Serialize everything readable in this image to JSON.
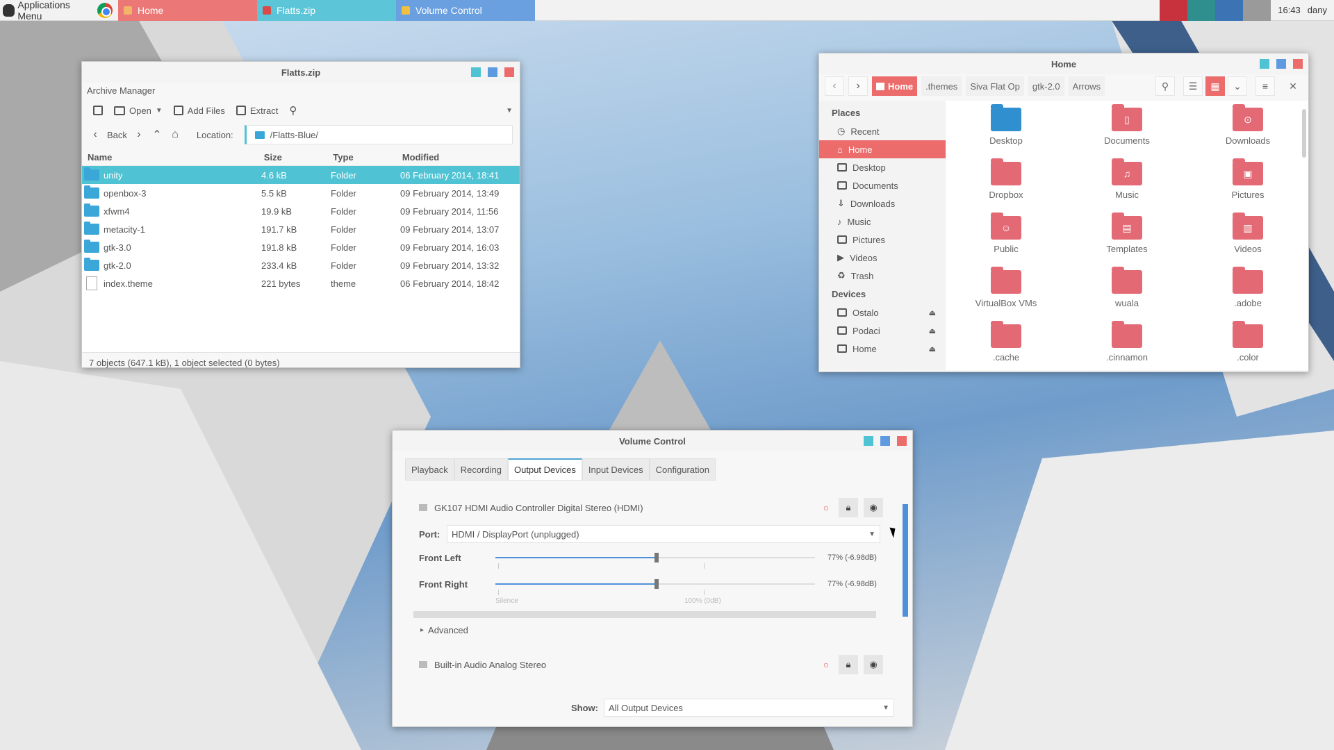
{
  "panel": {
    "app_menu": "Applications Menu",
    "tasks": [
      {
        "label": "Home",
        "color": "#ec7777"
      },
      {
        "label": "Flatts.zip",
        "color": "#5cc5d8"
      },
      {
        "label": "Volume Control",
        "color": "#6aa0e0"
      }
    ],
    "pager_colors": [
      "#c8323c",
      "#2f8f8f",
      "#3b73b5",
      "#9a9a9a"
    ],
    "clock": "16:43",
    "user": "dany"
  },
  "archive": {
    "title": "Flatts.zip",
    "app_name": "Archive Manager",
    "toolbar": {
      "open": "Open",
      "add_files": "Add Files",
      "extract": "Extract"
    },
    "nav": {
      "back": "Back",
      "location_label": "Location:",
      "location_value": "/Flatts-Blue/"
    },
    "columns": {
      "name": "Name",
      "size": "Size",
      "type": "Type",
      "modified": "Modified"
    },
    "rows": [
      {
        "name": "unity",
        "size": "4.6 kB",
        "type": "Folder",
        "modified": "06 February 2014, 18:41",
        "kind": "folder",
        "selected": true
      },
      {
        "name": "openbox-3",
        "size": "5.5 kB",
        "type": "Folder",
        "modified": "09 February 2014, 13:49",
        "kind": "folder"
      },
      {
        "name": "xfwm4",
        "size": "19.9 kB",
        "type": "Folder",
        "modified": "09 February 2014, 11:56",
        "kind": "folder"
      },
      {
        "name": "metacity-1",
        "size": "191.7 kB",
        "type": "Folder",
        "modified": "09 February 2014, 13:07",
        "kind": "folder"
      },
      {
        "name": "gtk-3.0",
        "size": "191.8 kB",
        "type": "Folder",
        "modified": "09 February 2014, 16:03",
        "kind": "folder"
      },
      {
        "name": "gtk-2.0",
        "size": "233.4 kB",
        "type": "Folder",
        "modified": "09 February 2014, 13:32",
        "kind": "folder"
      },
      {
        "name": "index.theme",
        "size": "221 bytes",
        "type": "theme",
        "modified": "06 February 2014, 18:42",
        "kind": "file"
      }
    ],
    "status": "7 objects (647.1 kB), 1 object selected (0 bytes)"
  },
  "files": {
    "title": "Home",
    "breadcrumbs": [
      "Home",
      ".themes",
      "Siva Flat Op",
      "gtk-2.0",
      "Arrows"
    ],
    "places_header": "Places",
    "places": [
      "Recent",
      "Home",
      "Desktop",
      "Documents",
      "Downloads",
      "Music",
      "Pictures",
      "Videos",
      "Trash"
    ],
    "devices_header": "Devices",
    "devices": [
      "Ostalo",
      "Podaci",
      "Home"
    ],
    "grid": [
      {
        "label": "Desktop",
        "icon": "desktop-folder-icon"
      },
      {
        "label": "Documents",
        "icon": "documents-folder-icon"
      },
      {
        "label": "Downloads",
        "icon": "downloads-folder-icon"
      },
      {
        "label": "Dropbox",
        "icon": "folder-icon"
      },
      {
        "label": "Music",
        "icon": "music-folder-icon"
      },
      {
        "label": "Pictures",
        "icon": "pictures-folder-icon"
      },
      {
        "label": "Public",
        "icon": "public-folder-icon"
      },
      {
        "label": "Templates",
        "icon": "templates-folder-icon"
      },
      {
        "label": "Videos",
        "icon": "videos-folder-icon"
      },
      {
        "label": "VirtualBox VMs",
        "icon": "folder-icon"
      },
      {
        "label": "wuala",
        "icon": "folder-icon"
      },
      {
        "label": ".adobe",
        "icon": "folder-icon"
      },
      {
        "label": ".cache",
        "icon": "folder-icon"
      },
      {
        "label": ".cinnamon",
        "icon": "folder-icon"
      },
      {
        "label": ".color",
        "icon": "folder-icon"
      }
    ]
  },
  "volume": {
    "title": "Volume Control",
    "tabs": [
      "Playback",
      "Recording",
      "Output Devices",
      "Input Devices",
      "Configuration"
    ],
    "active_tab": "Output Devices",
    "device1": {
      "name": "GK107 HDMI Audio Controller Digital Stereo (HDMI)",
      "port_label": "Port:",
      "port_value": "HDMI / DisplayPort (unplugged)",
      "channels": [
        {
          "label": "Front Left",
          "value": "77% (-6.98dB)",
          "level": 0.77
        },
        {
          "label": "Front Right",
          "value": "77% (-6.98dB)",
          "level": 0.77
        }
      ],
      "scale_silence": "Silence",
      "scale_full": "100% (0dB)",
      "advanced": "Advanced"
    },
    "device2": {
      "name": "Built-in Audio Analog Stereo"
    },
    "show_label": "Show:",
    "show_value": "All Output Devices"
  }
}
